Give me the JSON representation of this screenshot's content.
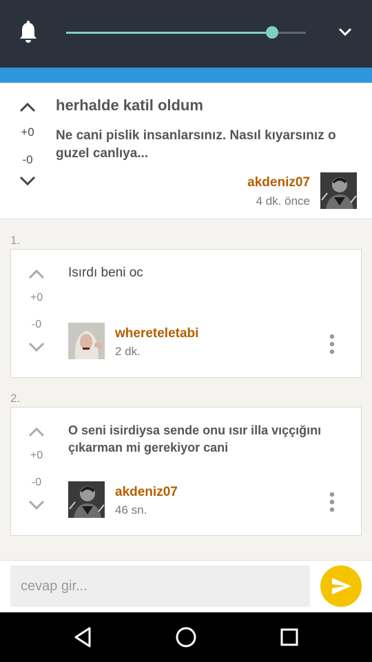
{
  "topbar": {
    "icons": {
      "bell": "bell-icon",
      "collapse": "chevron-down-icon"
    },
    "slider_level_percent": 86,
    "colors": {
      "bar": "#2b323b",
      "slider": "#7fd0c4",
      "accent_strip": "#2f96dc"
    }
  },
  "post": {
    "upvotes": "+0",
    "downvotes": "-0",
    "title": "herhalde katil oldum",
    "body": "Ne cani pislik insanlarsınız. Nasıl kıyarsınız o guzel canlıya...",
    "author": "akdeniz07",
    "time": "4 dk. önce"
  },
  "comments": [
    {
      "index": "1.",
      "upvotes": "+0",
      "downvotes": "-0",
      "text": "Isırdı beni oc",
      "author": "whereteletabi",
      "time": "2 dk."
    },
    {
      "index": "2.",
      "upvotes": "+0",
      "downvotes": "-0",
      "text": "O seni isirdiysa sende onu ısır illa vıççığını çıkarman mi gerekiyor cani",
      "author": "akdeniz07",
      "time": "46 sn."
    }
  ],
  "reply": {
    "placeholder": "cevap gir...",
    "send_icon": "send-icon",
    "send_color": "#f5c400"
  },
  "navbar": {
    "back": "back-icon",
    "home": "home-icon",
    "recents": "recents-icon"
  }
}
